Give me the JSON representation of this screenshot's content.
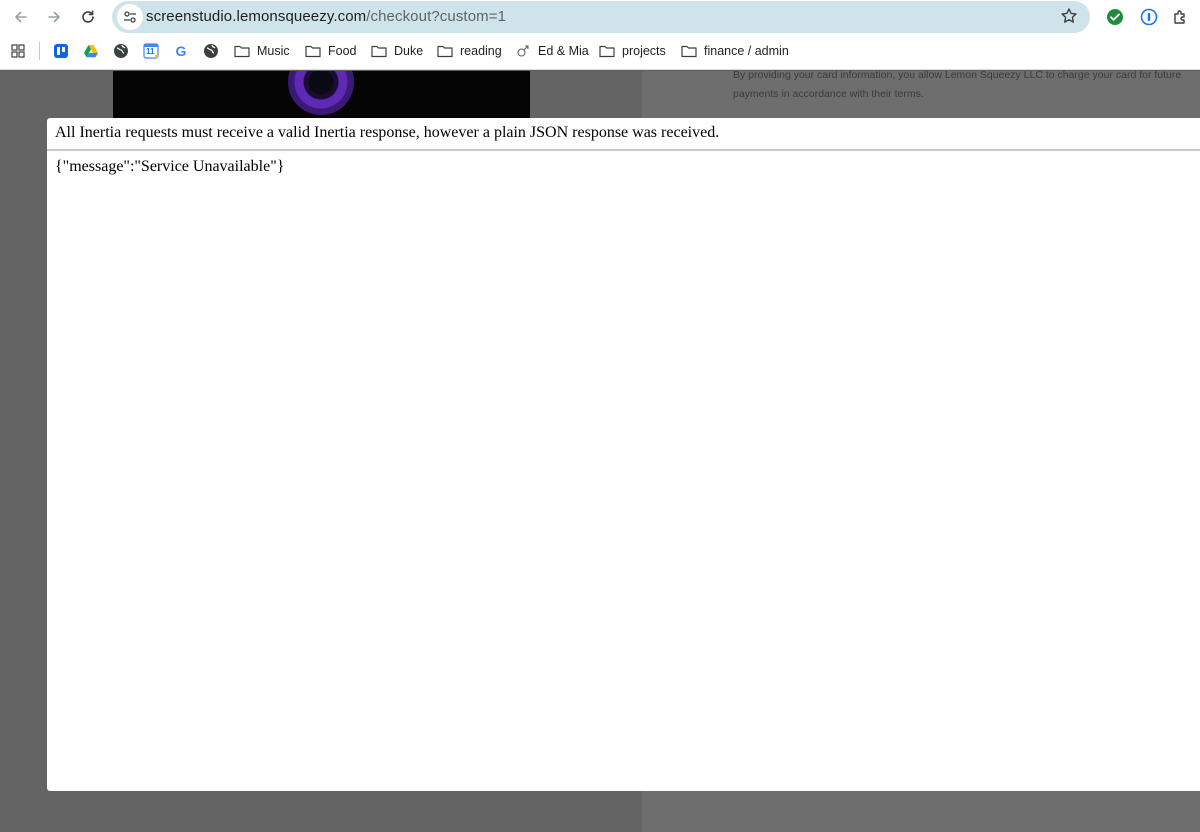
{
  "browser": {
    "url": {
      "host": "screenstudio.lemonsqueezy.com",
      "path": "/checkout?custom=1"
    },
    "bookmarks": [
      {
        "label": "Music"
      },
      {
        "label": "Food"
      },
      {
        "label": "Duke"
      },
      {
        "label": "reading"
      },
      {
        "label": "Ed & Mia"
      },
      {
        "label": "projects"
      },
      {
        "label": "finance / admin"
      }
    ],
    "calendar_day": "11",
    "google_letter": "G"
  },
  "page": {
    "terms_text": "By providing your card information, you allow Lemon Squeezy LLC to charge your card for future payments in accordance with their terms."
  },
  "error_modal": {
    "header": "All Inertia requests must receive a valid Inertia response, however a plain JSON response was received.",
    "body": "{\"message\":\"Service Unavailable\"}"
  },
  "colors": {
    "omnibox": "#cfe4ea",
    "overlay": "#6b6b6b",
    "modal_bg": "#ffffff",
    "ext_green": "#1e8e3e",
    "ext_blue": "#1a73e8"
  },
  "icons": [
    "back-arrow-icon",
    "forward-arrow-icon",
    "reload-icon",
    "site-info-icon",
    "bookmark-star-icon",
    "check-circle-icon",
    "password-manager-icon",
    "extensions-icon",
    "apps-grid-icon",
    "folder-icon",
    "globe-icon",
    "google-drive-icon",
    "calendar-icon",
    "trello-icon"
  ]
}
